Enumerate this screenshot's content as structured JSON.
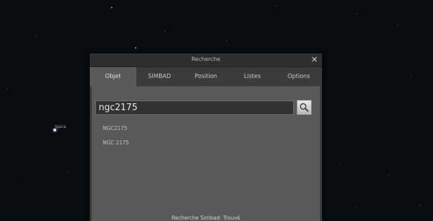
{
  "sky": {
    "spica_label": "Spica"
  },
  "dialog": {
    "title": "Recherche",
    "close_icon": "close-icon",
    "tabs": [
      {
        "label": "Objet",
        "active": true
      },
      {
        "label": "SIMBAD",
        "active": false
      },
      {
        "label": "Position",
        "active": false
      },
      {
        "label": "Listes",
        "active": false
      },
      {
        "label": "Options",
        "active": false
      }
    ],
    "search": {
      "value": "ngc2175",
      "icon": "magnifier-icon"
    },
    "results": [
      "NGC2175",
      "NGC 2175"
    ],
    "status": "Recherche Simbad: Trouvé"
  }
}
